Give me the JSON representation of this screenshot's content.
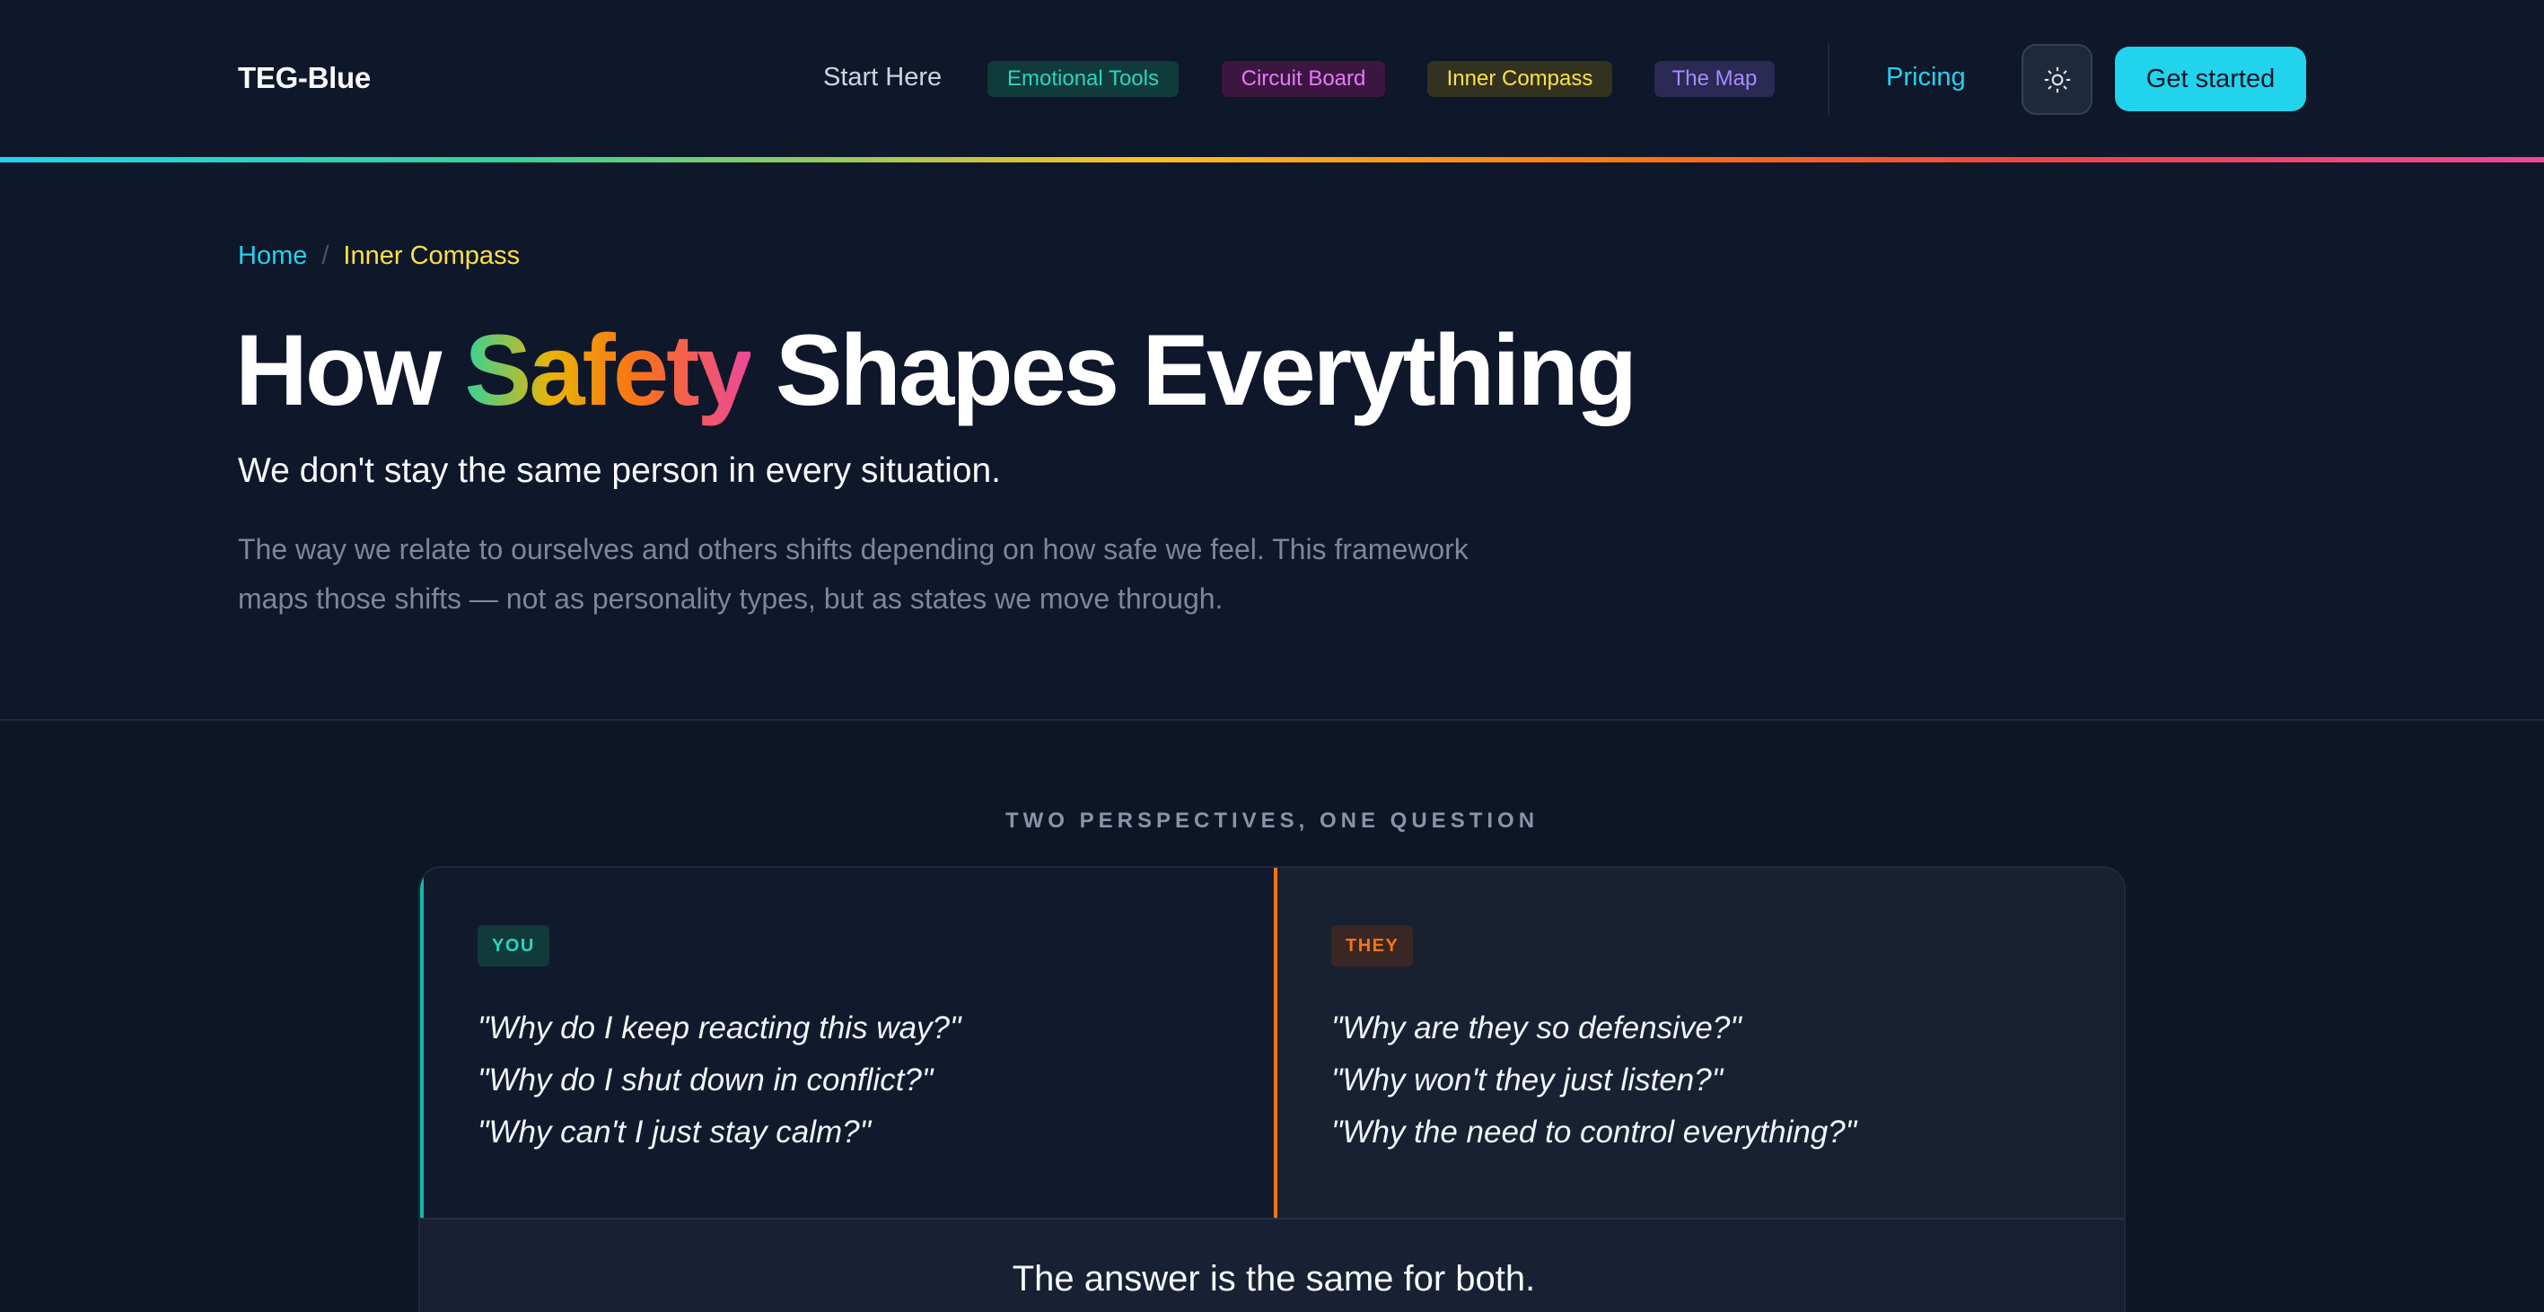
{
  "header": {
    "logo": "TEG-Blue",
    "nav": {
      "start_here": "Start Here",
      "emotional_tools": "Emotional Tools",
      "circuit_board": "Circuit Board",
      "inner_compass": "Inner Compass",
      "the_map": "The Map",
      "pricing": "Pricing"
    },
    "theme_toggle_icon": "sun-icon",
    "cta": "Get started"
  },
  "breadcrumb": {
    "home": "Home",
    "separator": "/",
    "current": "Inner Compass"
  },
  "hero": {
    "title_before": "How ",
    "title_highlight": "Safety",
    "title_after": " Shapes Everything",
    "subtitle": "We don't stay the same person in every situation.",
    "lead": "The way we relate to ourselves and others shifts depending on how safe we feel. This framework maps those shifts — not as personality types, but as states we move through."
  },
  "perspectives": {
    "eyebrow": "TWO PERSPECTIVES, ONE QUESTION",
    "you": {
      "tag": "YOU",
      "questions": [
        "\"Why do I keep reacting this way?\"",
        "\"Why do I shut down in conflict?\"",
        "\"Why can't I just stay calm?\""
      ]
    },
    "they": {
      "tag": "THEY",
      "questions": [
        "\"Why are they so defensive?\"",
        "\"Why won't they just listen?\"",
        "\"Why the need to control everything?\""
      ]
    },
    "answer": "The answer is the same for both."
  },
  "colors": {
    "background": "#0f172a",
    "accent_cyan": "#22d3ee",
    "teal": "#2dd4bf",
    "magenta": "#e879f9",
    "yellow": "#fde047",
    "violet": "#a78bfa",
    "orange": "#f97316"
  }
}
